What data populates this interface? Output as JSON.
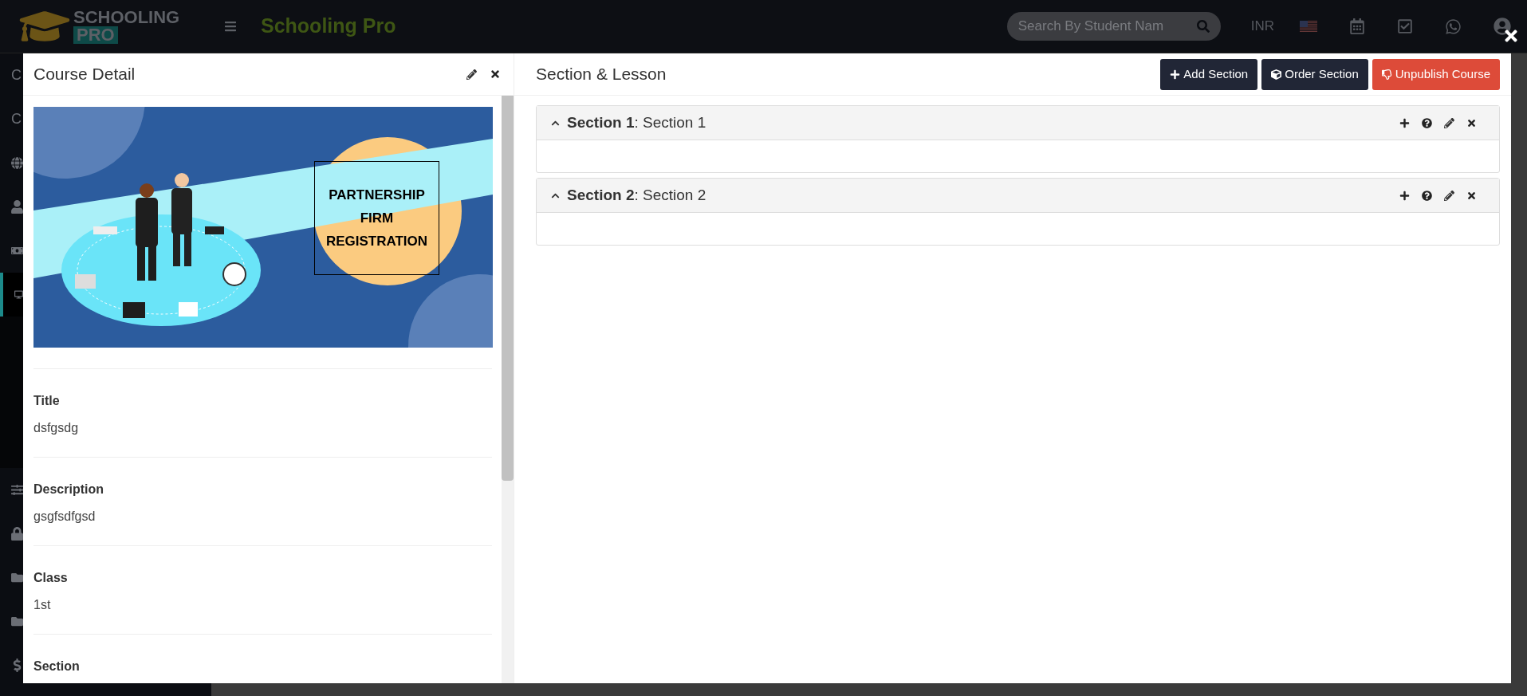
{
  "topbar": {
    "logo_top": "SCHOOLING",
    "logo_bottom": "PRO",
    "app_title": "Schooling Pro",
    "search": {
      "placeholder": "Search By Student Nam"
    },
    "currency": "INR"
  },
  "sidebar": {
    "items": [
      {
        "label": "C",
        "selected": false
      },
      {
        "label": "C",
        "selected": false
      },
      {
        "selected": false
      },
      {
        "selected": false
      },
      {
        "selected": false
      },
      {
        "selected": true
      },
      {
        "selected": false
      },
      {
        "selected": false
      },
      {
        "selected": false
      },
      {
        "selected": false
      },
      {
        "selected": false
      }
    ]
  },
  "course_detail": {
    "title": "Course Detail",
    "banner_text": [
      "PARTNERSHIP",
      "FIRM",
      "REGISTRATION"
    ],
    "fields": [
      {
        "label": "Title",
        "value": "dsfgsdg"
      },
      {
        "label": "Description",
        "value": "gsgfsdfgsd"
      },
      {
        "label": "Class",
        "value": "1st"
      },
      {
        "label": "Section"
      }
    ]
  },
  "section_lesson": {
    "title": "Section & Lesson",
    "buttons": [
      {
        "kind": "add",
        "label": "Add Section"
      },
      {
        "kind": "order",
        "label": "Order Section"
      },
      {
        "kind": "unpublish",
        "label": "Unpublish Course"
      }
    ],
    "sections": [
      {
        "title": "**Section 1**: Section 1",
        "expanded": true
      },
      {
        "title": "**Section 2**: Section 2",
        "expanded": true
      }
    ]
  }
}
